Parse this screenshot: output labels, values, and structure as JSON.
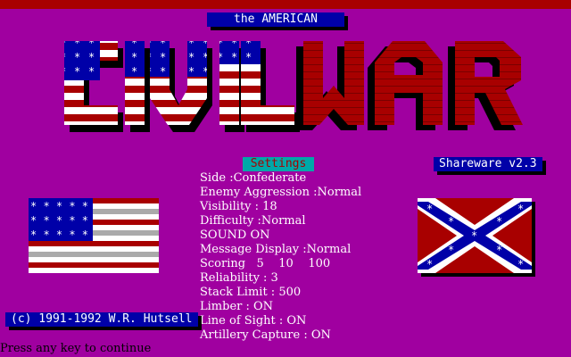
{
  "screen": {
    "subtitle": "the AMERICAN",
    "title_art": "CIVILWAR",
    "settings_header": "Settings",
    "shareware_badge": "Shareware v2.3",
    "copyright": "(c) 1991-1992 W.R. Hutsell",
    "continue_prompt": "Press any key to continue"
  },
  "settings": [
    {
      "text": "Side :Confederate"
    },
    {
      "text": "Enemy Aggression :Normal"
    },
    {
      "text": "Visibility : 18"
    },
    {
      "text": "Difficulty :Normal"
    },
    {
      "text": "SOUND ON"
    },
    {
      "text": "Message Display :Normal"
    },
    {
      "text": "Scoring   5    10    100"
    },
    {
      "text": "Reliability : 3"
    },
    {
      "text": "Stack Limit : 500"
    },
    {
      "text": "Limber : ON"
    },
    {
      "text": "Line of Sight : ON"
    },
    {
      "text": "Artillery Capture : ON"
    }
  ],
  "colors": {
    "background": "#a000a0",
    "union_blue": "#0000a8",
    "confederate_red": "#a80000",
    "stripe_white": "#ffffff",
    "settings_header_bg": "#00a8a8"
  },
  "icons": {
    "us_flag": "us-flag-icon",
    "confederate_flag": "confederate-flag-icon",
    "title_art": "civil-war-title-art"
  }
}
